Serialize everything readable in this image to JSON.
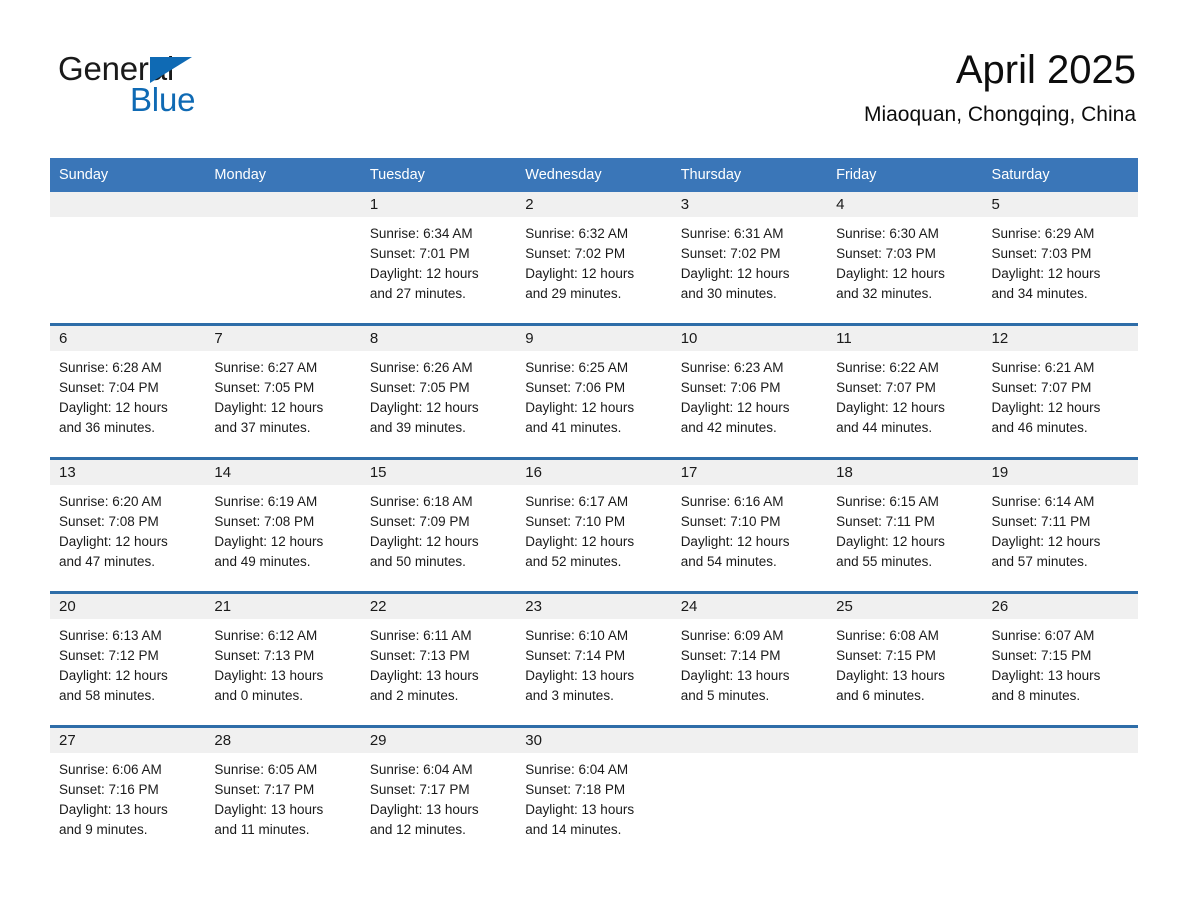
{
  "brand": {
    "word1": "General",
    "word2": "Blue",
    "triangle_color": "#0f6ab4",
    "text_color": "#1a1a1a"
  },
  "header": {
    "month_title": "April 2025",
    "location": "Miaoquan, Chongqing, China"
  },
  "theme": {
    "header_blue": "#3a76b8",
    "row_divider_blue": "#2e6da8",
    "daynum_band": "#f0f0f0",
    "cell_background": "#ffffff",
    "text": "#1a1a1a"
  },
  "weekday_headers": [
    "Sunday",
    "Monday",
    "Tuesday",
    "Wednesday",
    "Thursday",
    "Friday",
    "Saturday"
  ],
  "weeks": [
    [
      {
        "day": "",
        "lines": []
      },
      {
        "day": "",
        "lines": []
      },
      {
        "day": "1",
        "lines": [
          "Sunrise: 6:34 AM",
          "Sunset: 7:01 PM",
          "Daylight: 12 hours",
          "and 27 minutes."
        ]
      },
      {
        "day": "2",
        "lines": [
          "Sunrise: 6:32 AM",
          "Sunset: 7:02 PM",
          "Daylight: 12 hours",
          "and 29 minutes."
        ]
      },
      {
        "day": "3",
        "lines": [
          "Sunrise: 6:31 AM",
          "Sunset: 7:02 PM",
          "Daylight: 12 hours",
          "and 30 minutes."
        ]
      },
      {
        "day": "4",
        "lines": [
          "Sunrise: 6:30 AM",
          "Sunset: 7:03 PM",
          "Daylight: 12 hours",
          "and 32 minutes."
        ]
      },
      {
        "day": "5",
        "lines": [
          "Sunrise: 6:29 AM",
          "Sunset: 7:03 PM",
          "Daylight: 12 hours",
          "and 34 minutes."
        ]
      }
    ],
    [
      {
        "day": "6",
        "lines": [
          "Sunrise: 6:28 AM",
          "Sunset: 7:04 PM",
          "Daylight: 12 hours",
          "and 36 minutes."
        ]
      },
      {
        "day": "7",
        "lines": [
          "Sunrise: 6:27 AM",
          "Sunset: 7:05 PM",
          "Daylight: 12 hours",
          "and 37 minutes."
        ]
      },
      {
        "day": "8",
        "lines": [
          "Sunrise: 6:26 AM",
          "Sunset: 7:05 PM",
          "Daylight: 12 hours",
          "and 39 minutes."
        ]
      },
      {
        "day": "9",
        "lines": [
          "Sunrise: 6:25 AM",
          "Sunset: 7:06 PM",
          "Daylight: 12 hours",
          "and 41 minutes."
        ]
      },
      {
        "day": "10",
        "lines": [
          "Sunrise: 6:23 AM",
          "Sunset: 7:06 PM",
          "Daylight: 12 hours",
          "and 42 minutes."
        ]
      },
      {
        "day": "11",
        "lines": [
          "Sunrise: 6:22 AM",
          "Sunset: 7:07 PM",
          "Daylight: 12 hours",
          "and 44 minutes."
        ]
      },
      {
        "day": "12",
        "lines": [
          "Sunrise: 6:21 AM",
          "Sunset: 7:07 PM",
          "Daylight: 12 hours",
          "and 46 minutes."
        ]
      }
    ],
    [
      {
        "day": "13",
        "lines": [
          "Sunrise: 6:20 AM",
          "Sunset: 7:08 PM",
          "Daylight: 12 hours",
          "and 47 minutes."
        ]
      },
      {
        "day": "14",
        "lines": [
          "Sunrise: 6:19 AM",
          "Sunset: 7:08 PM",
          "Daylight: 12 hours",
          "and 49 minutes."
        ]
      },
      {
        "day": "15",
        "lines": [
          "Sunrise: 6:18 AM",
          "Sunset: 7:09 PM",
          "Daylight: 12 hours",
          "and 50 minutes."
        ]
      },
      {
        "day": "16",
        "lines": [
          "Sunrise: 6:17 AM",
          "Sunset: 7:10 PM",
          "Daylight: 12 hours",
          "and 52 minutes."
        ]
      },
      {
        "day": "17",
        "lines": [
          "Sunrise: 6:16 AM",
          "Sunset: 7:10 PM",
          "Daylight: 12 hours",
          "and 54 minutes."
        ]
      },
      {
        "day": "18",
        "lines": [
          "Sunrise: 6:15 AM",
          "Sunset: 7:11 PM",
          "Daylight: 12 hours",
          "and 55 minutes."
        ]
      },
      {
        "day": "19",
        "lines": [
          "Sunrise: 6:14 AM",
          "Sunset: 7:11 PM",
          "Daylight: 12 hours",
          "and 57 minutes."
        ]
      }
    ],
    [
      {
        "day": "20",
        "lines": [
          "Sunrise: 6:13 AM",
          "Sunset: 7:12 PM",
          "Daylight: 12 hours",
          "and 58 minutes."
        ]
      },
      {
        "day": "21",
        "lines": [
          "Sunrise: 6:12 AM",
          "Sunset: 7:13 PM",
          "Daylight: 13 hours",
          "and 0 minutes."
        ]
      },
      {
        "day": "22",
        "lines": [
          "Sunrise: 6:11 AM",
          "Sunset: 7:13 PM",
          "Daylight: 13 hours",
          "and 2 minutes."
        ]
      },
      {
        "day": "23",
        "lines": [
          "Sunrise: 6:10 AM",
          "Sunset: 7:14 PM",
          "Daylight: 13 hours",
          "and 3 minutes."
        ]
      },
      {
        "day": "24",
        "lines": [
          "Sunrise: 6:09 AM",
          "Sunset: 7:14 PM",
          "Daylight: 13 hours",
          "and 5 minutes."
        ]
      },
      {
        "day": "25",
        "lines": [
          "Sunrise: 6:08 AM",
          "Sunset: 7:15 PM",
          "Daylight: 13 hours",
          "and 6 minutes."
        ]
      },
      {
        "day": "26",
        "lines": [
          "Sunrise: 6:07 AM",
          "Sunset: 7:15 PM",
          "Daylight: 13 hours",
          "and 8 minutes."
        ]
      }
    ],
    [
      {
        "day": "27",
        "lines": [
          "Sunrise: 6:06 AM",
          "Sunset: 7:16 PM",
          "Daylight: 13 hours",
          "and 9 minutes."
        ]
      },
      {
        "day": "28",
        "lines": [
          "Sunrise: 6:05 AM",
          "Sunset: 7:17 PM",
          "Daylight: 13 hours",
          "and 11 minutes."
        ]
      },
      {
        "day": "29",
        "lines": [
          "Sunrise: 6:04 AM",
          "Sunset: 7:17 PM",
          "Daylight: 13 hours",
          "and 12 minutes."
        ]
      },
      {
        "day": "30",
        "lines": [
          "Sunrise: 6:04 AM",
          "Sunset: 7:18 PM",
          "Daylight: 13 hours",
          "and 14 minutes."
        ]
      },
      {
        "day": "",
        "lines": []
      },
      {
        "day": "",
        "lines": []
      },
      {
        "day": "",
        "lines": []
      }
    ]
  ]
}
